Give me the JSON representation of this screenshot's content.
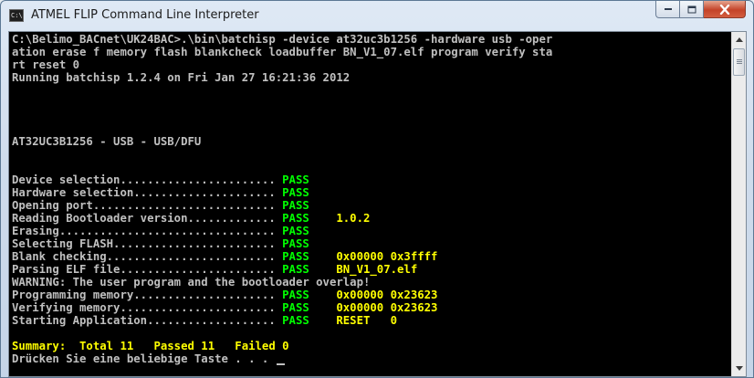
{
  "window": {
    "title": "ATMEL FLIP Command Line Interpreter",
    "icon": "C:\\"
  },
  "console": {
    "lines": [
      [
        {
          "text": "C:\\Belimo_BACnet\\UK24BAC>.\\bin\\batchisp -device at32uc3b1256 -hardware usb -oper"
        }
      ],
      [
        {
          "text": "ation erase f memory flash blankcheck loadbuffer BN_V1_07.elf program verify sta"
        }
      ],
      [
        {
          "text": "rt reset 0"
        }
      ],
      [
        {
          "text": "Running batchisp 1.2.4 on Fri Jan 27 16:21:36 2012"
        }
      ],
      [],
      [],
      [],
      [],
      [
        {
          "text": "AT32UC3B1256 - USB - USB/DFU"
        }
      ],
      [],
      [],
      [
        {
          "text": "Device selection....................... "
        },
        {
          "text": "PASS",
          "color": "pass"
        }
      ],
      [
        {
          "text": "Hardware selection..................... "
        },
        {
          "text": "PASS",
          "color": "pass"
        }
      ],
      [
        {
          "text": "Opening port........................... "
        },
        {
          "text": "PASS",
          "color": "pass"
        }
      ],
      [
        {
          "text": "Reading Bootloader version............. "
        },
        {
          "text": "PASS",
          "color": "pass"
        },
        {
          "text": "    1.0.2",
          "color": "yellow"
        }
      ],
      [
        {
          "text": "Erasing................................ "
        },
        {
          "text": "PASS",
          "color": "pass"
        }
      ],
      [
        {
          "text": "Selecting FLASH........................ "
        },
        {
          "text": "PASS",
          "color": "pass"
        }
      ],
      [
        {
          "text": "Blank checking......................... "
        },
        {
          "text": "PASS",
          "color": "pass"
        },
        {
          "text": "    0x00000 0x3ffff",
          "color": "yellow"
        }
      ],
      [
        {
          "text": "Parsing ELF file....................... "
        },
        {
          "text": "PASS",
          "color": "pass"
        },
        {
          "text": "    BN_V1_07.elf",
          "color": "yellow"
        }
      ],
      [
        {
          "text": "WARNING: The user program and the bootloader overlap!"
        }
      ],
      [
        {
          "text": "Programming memory..................... "
        },
        {
          "text": "PASS",
          "color": "pass"
        },
        {
          "text": "    0x00000 0x23623",
          "color": "yellow"
        }
      ],
      [
        {
          "text": "Verifying memory....................... "
        },
        {
          "text": "PASS",
          "color": "pass"
        },
        {
          "text": "    0x00000 0x23623",
          "color": "yellow"
        }
      ],
      [
        {
          "text": "Starting Application................... "
        },
        {
          "text": "PASS",
          "color": "pass"
        },
        {
          "text": "    RESET   0",
          "color": "yellow"
        }
      ],
      [],
      [
        {
          "text": "Summary:  Total 11   Passed 11   Failed 0",
          "color": "yellow"
        }
      ],
      [
        {
          "text": "Drücken Sie eine beliebige Taste . . . "
        }
      ]
    ]
  },
  "colors": {
    "console_bg": "#000000",
    "console_text": "#c0c0c0",
    "pass": "#00ff00",
    "yellow": "#ffff00"
  }
}
